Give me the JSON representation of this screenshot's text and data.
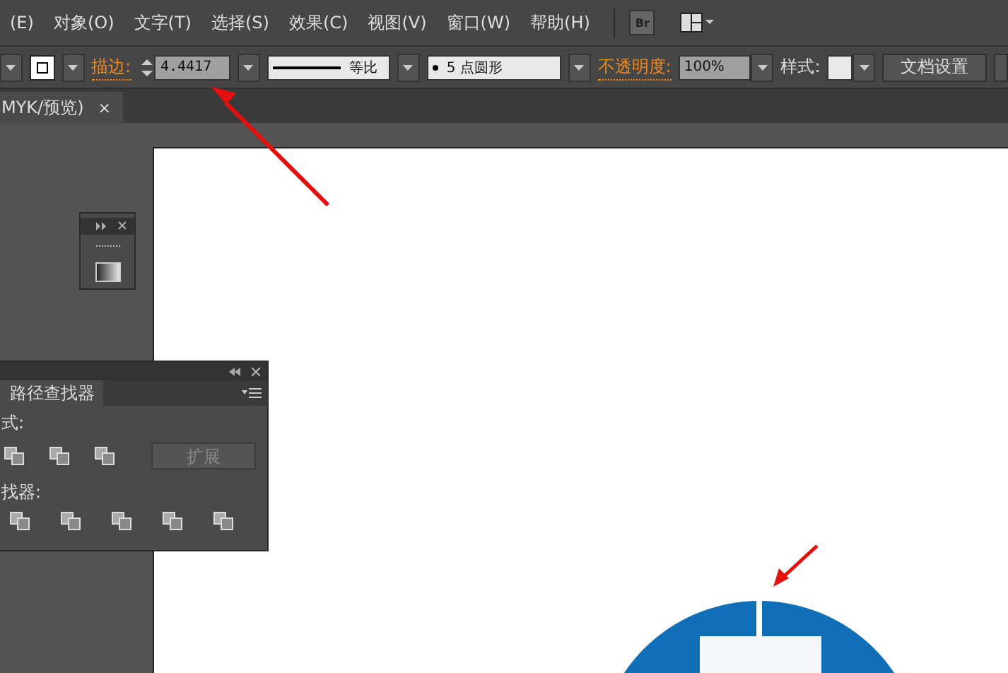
{
  "menu": [
    "(E)",
    "对象(O)",
    "文字(T)",
    "选择(S)",
    "效果(C)",
    "视图(V)",
    "窗口(W)",
    "帮助(H)"
  ],
  "bridge_button": "Br",
  "control_bar": {
    "stroke_label": "描边:",
    "stroke_value": "4.4417",
    "profile_label": "等比",
    "brush_label": "5 点圆形",
    "opacity_label": "不透明度:",
    "opacity_value": "100%",
    "style_label": "样式:",
    "doc_setup_button": "文档设置"
  },
  "document_tab": {
    "title": "MYK/预览)",
    "close": "×"
  },
  "pathfinder_panel": {
    "tab": "路径查找器",
    "shape_modes_label": "式:",
    "expand_button": "扩展",
    "pathfinders_label": "找器:"
  }
}
